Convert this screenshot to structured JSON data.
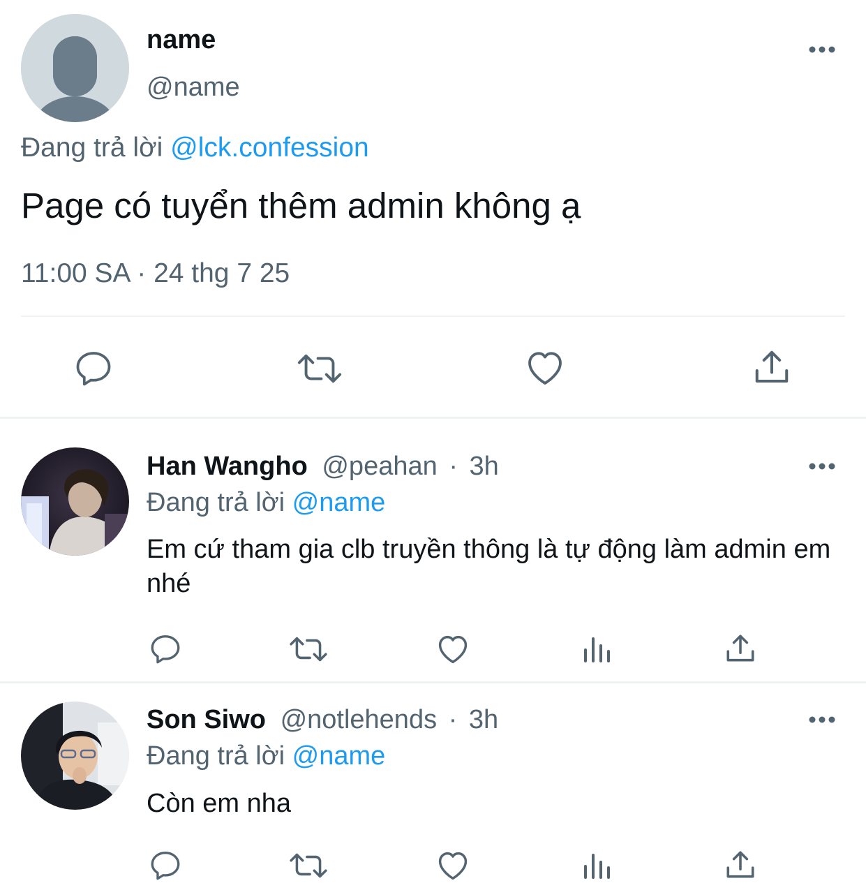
{
  "main_tweet": {
    "author_name": "name",
    "author_handle": "@name",
    "replying_prefix": "Đang trả lời",
    "replying_to": "@lck.confession",
    "text": "Page có tuyển thêm admin không ạ",
    "timestamp": "11:00 SA · 24 thg 7 25",
    "avatar_icon": "default-profile-icon",
    "actions": [
      "reply-icon",
      "retweet-icon",
      "like-icon",
      "share-icon"
    ]
  },
  "replies": [
    {
      "name": "Han Wangho",
      "handle": "@peahan",
      "separator": "·",
      "time": "3h",
      "replying_prefix": "Đang trả lời",
      "replying_to": "@name",
      "text": "Em cứ tham gia clb truyền thông là tự động làm admin em nhé",
      "actions": [
        "reply-icon",
        "retweet-icon",
        "like-icon",
        "views-icon",
        "share-icon"
      ]
    },
    {
      "name": "Son Siwo",
      "handle": "@notlehends",
      "separator": "·",
      "time": "3h",
      "replying_prefix": "Đang trả lời",
      "replying_to": "@name",
      "text": "Còn em nha",
      "actions": [
        "reply-icon",
        "retweet-icon",
        "like-icon",
        "views-icon",
        "share-icon"
      ]
    }
  ],
  "colors": {
    "text_primary": "#0f1419",
    "text_secondary": "#536471",
    "accent": "#1d9bf0",
    "divider": "#eff3f4",
    "icon": "#536471"
  }
}
